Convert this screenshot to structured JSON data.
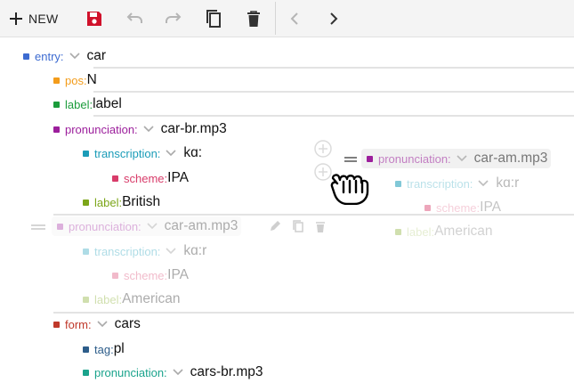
{
  "toolbar": {
    "new_label": "NEW",
    "buttons": [
      "add-icon",
      "save-icon",
      "undo-icon",
      "redo-icon",
      "duplicate-icon",
      "delete-icon",
      "back-icon",
      "forward-icon"
    ]
  },
  "colors": {
    "entry": "#3d6bd1",
    "pos": "#f39c1b",
    "label": "#1b9c3b",
    "pronunciation": "#9c1f9c",
    "transcription": "#1b9cb8",
    "scheme": "#d83c6a",
    "label_lime": "#7ca61a",
    "form": "#c0392b",
    "tag": "#2d5d8a",
    "pron_teal": "#1aa38c",
    "save": "#d0112b"
  },
  "tree": {
    "entry": {
      "key": "entry:",
      "value": "car"
    },
    "pos": {
      "key": "pos:",
      "value": "N"
    },
    "label": {
      "key": "label:",
      "value": "label"
    },
    "pronunciation_1": {
      "key": "pronunciation:",
      "value": "car-br.mp3"
    },
    "transcription_1": {
      "key": "transcription:",
      "value": "kɑ:"
    },
    "scheme_1": {
      "key": "scheme:",
      "value": "IPA"
    },
    "label_1": {
      "key": "label:",
      "value": "British"
    },
    "pronunciation_2": {
      "key": "pronunciation:",
      "value": "car-am.mp3"
    },
    "transcription_2": {
      "key": "transcription:",
      "value": "kɑ:r"
    },
    "scheme_2": {
      "key": "scheme:",
      "value": "IPA"
    },
    "label_2": {
      "key": "label:",
      "value": "American"
    },
    "form": {
      "key": "form:",
      "value": "cars"
    },
    "tag": {
      "key": "tag:",
      "value": "pl"
    },
    "pronunciation_3": {
      "key": "pronunciation:",
      "value": "cars-br.mp3"
    }
  },
  "drag_ghost": {
    "pronunciation": {
      "key": "pronunciation:",
      "value": "car-am.mp3"
    },
    "transcription": {
      "key": "transcription:",
      "value": "kɑ:r"
    },
    "scheme": {
      "key": "scheme:",
      "value": "IPA"
    },
    "label": {
      "key": "label:",
      "value": "American"
    }
  }
}
